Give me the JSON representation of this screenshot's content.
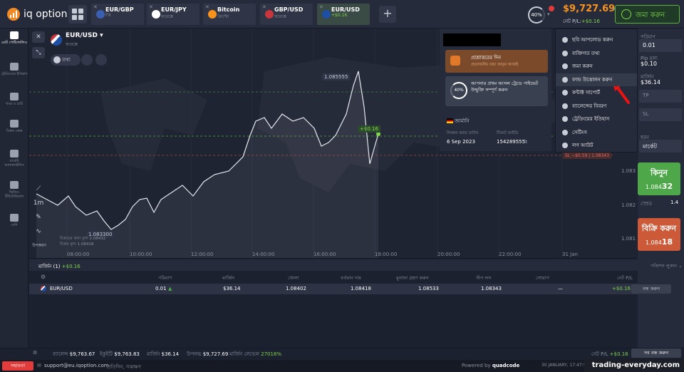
{
  "header": {
    "logo_text": "iq option",
    "tabs": [
      {
        "name": "EUR/GBP",
        "sub": "FX",
        "flag": "#3a5fb0",
        "active": false
      },
      {
        "name": "EUR/JPY",
        "sub": "ফরেক্সে",
        "flag": "#fff",
        "active": false
      },
      {
        "name": "Bitcoin",
        "sub": "ক্রিপ্টো",
        "flag": "#f7931a",
        "active": false
      },
      {
        "name": "GBP/USD",
        "sub": "ফরেক্সে",
        "flag": "#c7353d",
        "active": false
      },
      {
        "name": "EUR/USD",
        "sub": "+$0.16",
        "flag": "#1f4ea5",
        "active": true
      }
    ],
    "add_tab": "+",
    "leverage": "40%",
    "balance": "$9,727.69",
    "pnl_label": "নেট P/L:",
    "pnl_value": "+$0.16",
    "deposit_label": "জমা করুন"
  },
  "sidebar": {
    "items": [
      {
        "label": "মোট পোর্টফোলিও",
        "icon": "portfolio-icon",
        "selected": true
      },
      {
        "label": "ট্রেডিংয়ের ইতিহাস",
        "icon": "history-icon",
        "selected": false
      },
      {
        "label": "খবর ও চ্যাট",
        "icon": "chat-icon",
        "selected": false
      },
      {
        "label": "বিক্রয় কেন্দ্র",
        "icon": "market-icon",
        "selected": false
      },
      {
        "label": "মার্কেট অ্যানালাইসিস",
        "icon": "analysis-icon",
        "selected": false
      },
      {
        "label": "ভিডিও টিউটোরিয়াল",
        "icon": "video-icon",
        "selected": false
      },
      {
        "label": "বেশি",
        "icon": "more-icon",
        "selected": false
      }
    ]
  },
  "chart": {
    "asset_name": "EUR/USD",
    "asset_type": "ফরেক্সে",
    "info_label": "তথ্য",
    "close_label": "✕",
    "tool_label": "উপকরণ",
    "timeframe": "1m",
    "peak_label": "1.085555",
    "low_label": "1.083300",
    "pnl_label": "+$0.16",
    "sl_label": "SL −$0.59",
    "sl_price": "1.08343",
    "open_label": "বিক্রয়ের জন্য মূল্য",
    "open_price": "1.08432",
    "strike_label": "বিক্রয় মূল্য",
    "strike_price": "1.08418",
    "right_ticks": [
      "1.083",
      "1.082",
      "1.081"
    ],
    "x_ticks": [
      "08:00:00",
      "10:00:00",
      "12:00:00",
      "14:00:00",
      "16:00:00",
      "18:00:00",
      "20:00:00",
      "22:00:00",
      "31 Jan"
    ]
  },
  "info_panel": {
    "box1_title": "প্রশ্নোত্তরের দিন",
    "box1_sub": "প্রয়োজনীয় তথ্য জানুন আজই",
    "box2_pct": "40%",
    "box2_text": "আপনার প্রথম আসল ট্রেডে পাইভেট উন্মুক্তি সম্পূর্ণ করুন",
    "country": "জার্মানি",
    "reg_label": "নিবন্ধন করার তারিখ",
    "reg_date": "6 Sep 2023",
    "id_label": "টিকেট আইডি",
    "id_value": "154289555"
  },
  "menu": {
    "items": [
      {
        "label": "ছবি আপলোড করুন",
        "icon": "camera-icon",
        "hl": false
      },
      {
        "label": "ব্যক্তিগত তথ্য",
        "icon": "user-icon",
        "hl": false
      },
      {
        "label": "জমা করুন",
        "icon": "deposit-icon",
        "hl": false
      },
      {
        "label": "ফান্ড উত্তোলন করুন",
        "icon": "withdraw-icon",
        "hl": true
      },
      {
        "label": "কন্টাক্ট সাপোর্ট",
        "icon": "help-icon",
        "hl": false
      },
      {
        "label": "ব্যালেন্সের বিবরণ",
        "icon": "balance-icon",
        "hl": false
      },
      {
        "label": "ট্রেডিংয়ের ইতিহাস",
        "icon": "history-icon",
        "hl": false
      },
      {
        "label": "সেটিংস",
        "icon": "settings-icon",
        "hl": false
      },
      {
        "label": "লগ আউট",
        "icon": "logout-icon",
        "hl": false
      }
    ]
  },
  "trade": {
    "amount_label": "পরিমাণ",
    "amount": "0.01",
    "pip_label": "Pip মূল্য",
    "pip": "$0.10",
    "margin_label": "মার্জিন",
    "margin": "$36.14",
    "tp_label": "TP",
    "sl_label": "SL",
    "type_label": "ধরন",
    "type": "মার্কেট",
    "buy_label": "কিনুন",
    "buy_price": "1.084",
    "buy_price_big": "32",
    "spread_label": "স্প্রেড",
    "spread": "1.4",
    "sell_label": "বিক্রি করুন",
    "sell_price": "1.084",
    "sell_price_big": "18"
  },
  "positions": {
    "tab": "মার্জিন (1)",
    "tab_pnl": "+$0.16",
    "settings": "পজিশন লুকান ⌄",
    "headers": [
      "পরিমাণ",
      "মার্জিন",
      "খোলা",
      "বর্তমান দাম",
      "মুনাফা গ্রহণ করুন",
      "স্টপ লস",
      "সোয়াপ",
      "নেট P/L"
    ],
    "row": {
      "asset": "EUR/USD",
      "amount": "0.01",
      "margin": "$36.14",
      "open": "1.08402",
      "current": "1.08418",
      "tp": "1.08533",
      "sl": "1.08343",
      "swap": "—",
      "pnl": "+$0.16",
      "close": "বন্ধ করুন"
    }
  },
  "footer": {
    "balance_label": "ব্যালেন্স",
    "balance": "$9,763.67",
    "equity_label": "ইকুইটি",
    "equity": "$9,763.83",
    "margin_label": "মার্জিন",
    "margin": "$36.14",
    "available_label": "উপলব্ধ",
    "available": "$9,727.69",
    "level_label": "মার্জিন লেভেল",
    "level": "27016%",
    "net_label": "নেট P/L",
    "net": "+$0.16",
    "close_all": "সব বন্ধ করুন",
    "support": "সহায়তা",
    "email": "support@eu.iqoption.com",
    "privacy": "প্রতিদিন, সব্বক্ষণ",
    "powered": "Powered by",
    "powered_brand": "quadcode",
    "time": "30 JANUARY, 17:47:57 (UTC+1)",
    "watermark": "trading-everyday.com"
  }
}
